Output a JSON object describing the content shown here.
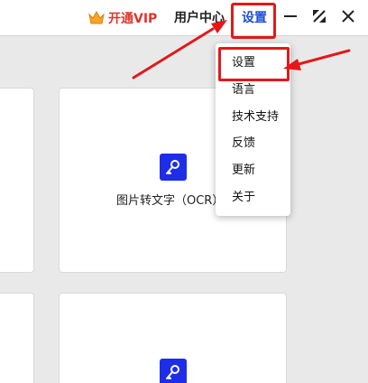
{
  "titlebar": {
    "vip_label": "开通VIP",
    "user_center_label": "用户中心",
    "settings_label": "设置"
  },
  "menu": {
    "items": [
      {
        "label": "设置"
      },
      {
        "label": "语言"
      },
      {
        "label": "技术支持"
      },
      {
        "label": "反馈"
      },
      {
        "label": "更新"
      },
      {
        "label": "关于"
      }
    ]
  },
  "cards": {
    "ocr_label": "图片转文字（OCR）"
  },
  "colors": {
    "accent_red": "#e31818",
    "vip_red": "#e1332a",
    "link_blue": "#1f4fd6",
    "icon_blue": "#1e2ee8"
  },
  "icons": {
    "vip": "crown-icon",
    "minimize": "minimize-icon",
    "maximize": "maximize-icon",
    "close": "close-icon",
    "ocr": "key-icon"
  }
}
